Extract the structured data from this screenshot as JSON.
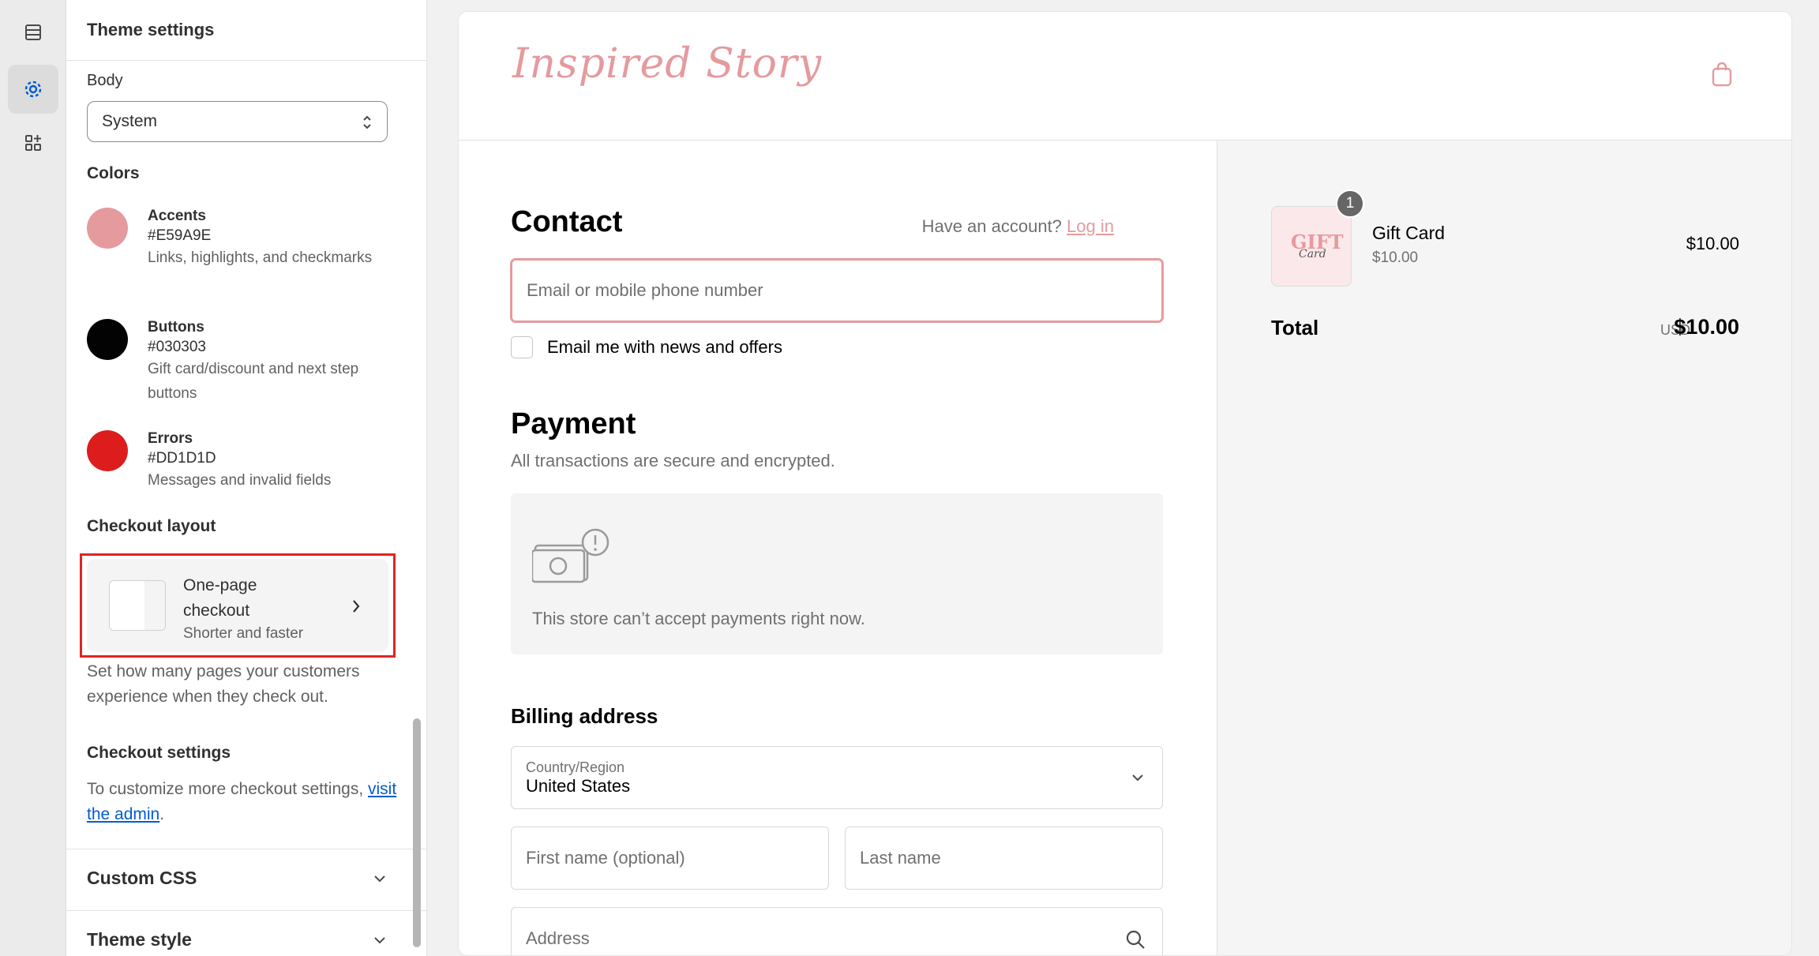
{
  "rail": {
    "items": [
      {
        "name": "sections-icon"
      },
      {
        "name": "settings-icon"
      },
      {
        "name": "apps-icon"
      }
    ]
  },
  "panel": {
    "title": "Theme settings",
    "body_label": "Body",
    "body_font_value": "System",
    "colors_heading": "Colors",
    "colors": [
      {
        "name": "Accents",
        "hex": "#E59A9E",
        "desc": "Links, highlights, and checkmarks",
        "swatch": "#E59A9E"
      },
      {
        "name": "Buttons",
        "hex": "#030303",
        "desc": "Gift card/discount and next step buttons",
        "swatch": "#030303"
      },
      {
        "name": "Errors",
        "hex": "#DD1D1D",
        "desc": "Messages and invalid fields",
        "swatch": "#DD1D1D"
      }
    ],
    "checkout_layout_heading": "Checkout layout",
    "layout_title": "One-page checkout",
    "layout_subtitle": "Shorter and faster",
    "layout_help": "Set how many pages your customers experience when they check out.",
    "checkout_settings_heading": "Checkout settings",
    "checkout_settings_text": "To customize more checkout settings,",
    "checkout_settings_link": "visit the admin",
    "checkout_settings_period": ".",
    "custom_css": "Custom CSS",
    "theme_style": "Theme style"
  },
  "preview": {
    "logo": "Inspired Story",
    "contact_heading": "Contact",
    "account_prompt": "Have an account?",
    "login_link": "Log in",
    "email_placeholder": "Email or mobile phone number",
    "newsletter_label": "Email me with news and offers",
    "payment_heading": "Payment",
    "payment_sub": "All transactions are secure and encrypted.",
    "payment_msg": "This store can’t accept payments right now.",
    "billing_heading": "Billing address",
    "country_label": "Country/Region",
    "country_value": "United States",
    "first_name_placeholder": "First name (optional)",
    "last_name_placeholder": "Last name",
    "address_placeholder": "Address"
  },
  "summary": {
    "item_thumb_text": "GIFT",
    "item_thumb_script": "Card",
    "quantity": "1",
    "item_name": "Gift Card",
    "item_unit_price": "$10.00",
    "item_price": "$10.00",
    "total_label": "Total",
    "currency": "USD",
    "total_value": "$10.00"
  },
  "colors": {
    "accent": "#E59A9E",
    "highlight_border": "#E02424",
    "link": "#005BD3"
  }
}
